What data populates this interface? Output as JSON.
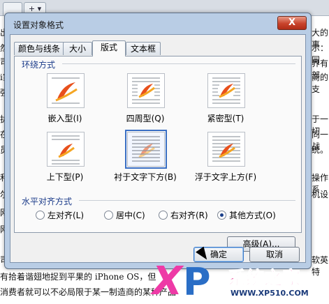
{
  "dialog": {
    "title": "设置对象格式",
    "close_label": "X",
    "tabs": [
      {
        "label": "颜色与线条",
        "active": false
      },
      {
        "label": "大小",
        "active": false
      },
      {
        "label": "版式",
        "active": true
      },
      {
        "label": "文本框",
        "active": false
      }
    ],
    "wrap_group_title": "环绕方式",
    "wrap_styles": [
      {
        "label": "嵌入型(I)",
        "icon": "inline-wrap-icon"
      },
      {
        "label": "四周型(Q)",
        "icon": "square-wrap-icon"
      },
      {
        "label": "紧密型(T)",
        "icon": "tight-wrap-icon"
      },
      {
        "label": "上下型(P)",
        "icon": "top-bottom-wrap-icon"
      },
      {
        "label": "衬于文字下方(B)",
        "icon": "behind-text-wrap-icon",
        "selected": true
      },
      {
        "label": "浮于文字上方(F)",
        "icon": "in-front-text-wrap-icon"
      }
    ],
    "align_group_title": "水平对齐方式",
    "align_options": [
      {
        "label": "左对齐(L)",
        "checked": false
      },
      {
        "label": "居中(C)",
        "checked": false
      },
      {
        "label": "右对齐(R)",
        "checked": false
      },
      {
        "label": "其他方式(O)",
        "checked": true
      }
    ],
    "advanced_label": "高级(A)...",
    "ok_label": "确定",
    "cancel_label": "取消"
  },
  "background": {
    "tab_label": "+",
    "left_chars": [
      "出",
      "然",
      "司",
      "i家",
      "强特",
      "拢",
      "在",
      "员",
      "和",
      "网",
      "尔",
      "网",
      "司",
      "有",
      "消"
    ],
    "right_chars": [
      "大的事",
      "示：同",
      "界有部",
      "商的支",
      "",
      "于一切",
      "同一战",
      "统。",
      "",
      "操作系",
      "机设",
      "",
      "",
      "",
      "软英特"
    ],
    "bottom_line_1": "有拾着谐翅地捉到平果的 iPhone OS，但",
    "bottom_line_2": "消费者就可以不必局限于某一制造商的某种产品"
  },
  "watermark": {
    "letter_x": "X",
    "letter_p": "P",
    "name": "系统之家",
    "url": "WWW.XP510.COM"
  },
  "colors": {
    "dialog_frame": "#b9cde5",
    "close_button": "#c8432b",
    "accent": "#3a6fc4"
  }
}
